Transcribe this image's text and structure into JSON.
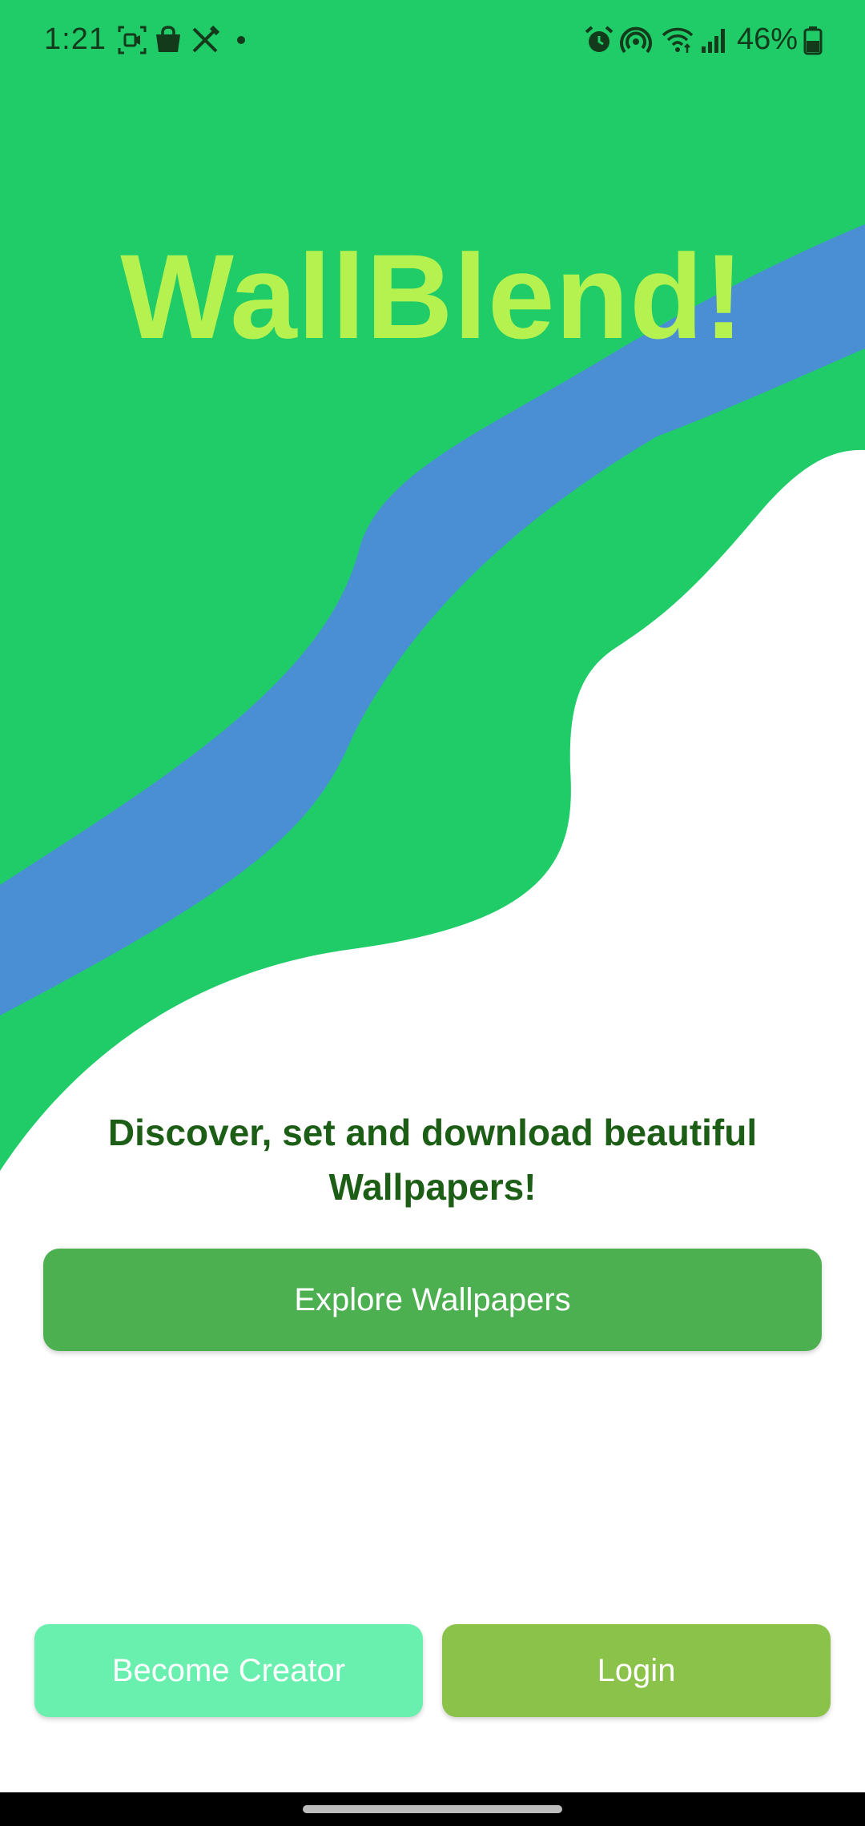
{
  "status_bar": {
    "time": "1:21",
    "battery": "46%",
    "left_icons": [
      "screen-record-icon",
      "shopping-bag-icon",
      "tools-icon",
      "notification-dot-icon"
    ],
    "right_icons": [
      "alarm-icon",
      "hotspot-icon",
      "wifi-icon",
      "signal-icon",
      "battery-icon"
    ]
  },
  "app": {
    "title": "WallBlend!",
    "tagline": "Discover, set and download beautiful Wallpapers!"
  },
  "buttons": {
    "explore": "Explore Wallpapers",
    "become_creator": "Become Creator",
    "login": "Login"
  },
  "colors": {
    "background_green": "#1fcc68",
    "stripe_blue": "#4a8fd4",
    "title_lime": "#b6f24f",
    "tagline_green": "#1d5e17",
    "explore_button": "#4caf50",
    "creator_button": "#69f0ae",
    "login_button": "#8bc34a"
  }
}
